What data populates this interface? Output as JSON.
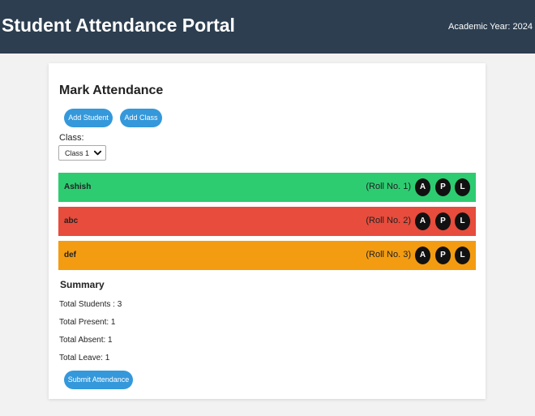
{
  "header": {
    "title": "Student Attendance Portal",
    "academic_year": "Academic Year: 2024",
    "bg_color": "#2c3e50"
  },
  "main": {
    "heading": "Mark Attendance",
    "buttons": {
      "add_student": "Add Student",
      "add_class": "Add Class"
    },
    "class_label": "Class:",
    "class_select": {
      "selected": "Class 1"
    },
    "students": [
      {
        "name": "Ashish",
        "roll": "(Roll No. 1)",
        "status_color": "#2ecc71"
      },
      {
        "name": "abc",
        "roll": "(Roll No. 2)",
        "status_color": "#e74c3c"
      },
      {
        "name": "def",
        "roll": "(Roll No. 3)",
        "status_color": "#f39c12"
      }
    ],
    "status_buttons": [
      "A",
      "P",
      "L"
    ],
    "summary": {
      "title": "Summary",
      "total_students": "Total Students : 3",
      "total_present": "Total Present: 1",
      "total_absent": "Total Absent: 1",
      "total_leave": "Total Leave: 1"
    },
    "submit_label": "Submit Attendance",
    "accent_color": "#3498db"
  }
}
